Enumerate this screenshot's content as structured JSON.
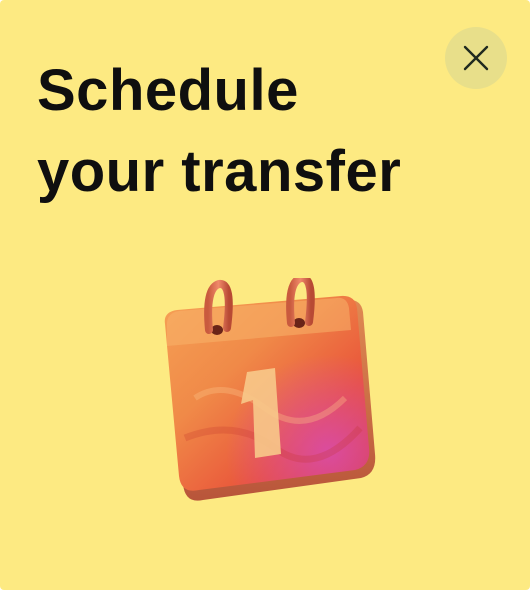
{
  "dialog": {
    "title_line1": "Schedule",
    "title_line2": "your transfer",
    "calendar_day": "1"
  },
  "close_button": {
    "icon": "close-icon"
  },
  "illustration": {
    "icon": "calendar-icon"
  },
  "colors": {
    "background": "#fdea82",
    "close_button_bg": "#e8df8a",
    "title_text": "#0f0f0f",
    "calendar_main": "#ee6a3c",
    "calendar_ring": "#e06a4a"
  }
}
